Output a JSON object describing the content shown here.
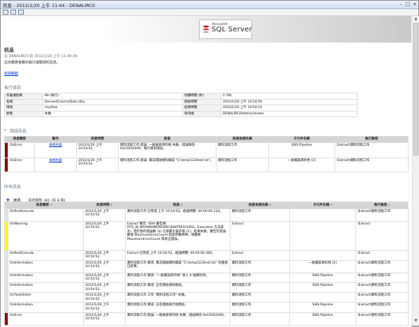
{
  "window": {
    "title": "訊息 - 2012/1/20 上午 11:44 - DENALIRC0"
  },
  "header": {
    "logo_small": "Microsoft®",
    "logo_text": "SQL Server",
    "title": "訊息",
    "subtitle": "在 DENALIRC0 的 2012/1/20 上午 11:44:34",
    "description": "這份報表會顯示執行或驗證的訊息。",
    "nav_link": "檢視概觀"
  },
  "exec_info": {
    "section": "執行資訊",
    "left": [
      {
        "label": "作業識別碼",
        "value": "89 (執行)"
      },
      {
        "label": "名稱",
        "value": "DerivedColumnData.dtsx"
      },
      {
        "label": "環境",
        "value": "/myflow"
      },
      {
        "label": "狀態",
        "value": "失敗"
      }
    ],
    "right": [
      {
        "label": "持續時間 (秒)",
        "value": "2.781"
      },
      {
        "label": "開始時間",
        "value": "2012/1/20 上午 10:54:50"
      },
      {
        "label": "結束時間",
        "value": "2012/1/20 上午 10:54:53"
      },
      {
        "label": "呼叫端",
        "value": "DENALIRC0\\Administrator"
      }
    ]
  },
  "errors": {
    "section": "錯誤訊息",
    "columns": [
      "訊息類型",
      "動作",
      "訊息時間",
      "訊息",
      "訊息來源名稱",
      "子元件名稱",
      "執行路徑"
    ],
    "rows": [
      {
        "type": "OnError",
        "action": "檢視內容",
        "time": "2012/1/20 上午 10:54:52",
        "message": "資料流程工作:錯誤: 一般檢索目的地 失敗，錯誤碼為 0xC0202009，執行目前階段。",
        "source": "資料流程工作",
        "component": "SSIS.Pipeline",
        "path": "\\Extract\\資料流程工作"
      },
      {
        "type": "OnError",
        "action": "檢視內容",
        "time": "2012/1/20 上午 10:54:52",
        "message": "資料流程工作:錯誤: 無法開啟資料檔案 \"C:\\temp\\123test.txt\"。",
        "source": "資料流程工作",
        "component": "一般檔案目的地 [2]",
        "path": "\\Extract\\資料流程工作"
      }
    ]
  },
  "all_messages": {
    "section": "所有訊息",
    "filter_label": "篩選:",
    "filter_value": "訊息類型: All; (共 4 個)",
    "columns": [
      "訊息類型",
      "訊息時間",
      "訊息",
      "訊息來源名稱",
      "子元件名稱",
      "執行路徑"
    ],
    "rows": [
      {
        "type": "OnPostExecute",
        "time": "2012/1/20 上午 10:54:52",
        "message": "資料流程工作 已完成 上午 10:54:52，經過時間: 00:00:00.234。",
        "source": "資料流程工作",
        "component": "",
        "path": "\\Extract\\資料流程工作"
      },
      {
        "type": "OnWarning",
        "time": "2012/1/20 上午 10:54:52",
        "message": "Extract 警告: SSIS 警告碼 DTS_W_MAXIMUMERRORCOUNTREACHED。Execution 方法成功，但引發的錯誤數 (2) 已達最大容許值 (1)；結果失敗。警告於錯誤數達 MaximumErrorCount 指定的數目時。請變更 MaximumErrorCount 或修正錯誤。",
        "source": "Extract",
        "component": "",
        "path": "\\Extract"
      },
      {
        "type": "OnPostExecute",
        "time": "2012/1/20 上午 10:54:52",
        "message": "Extract 已完成 上午 10:54:52，經過時間: 00:00:00.360。",
        "source": "Extract",
        "component": "",
        "path": "\\Extract"
      },
      {
        "type": "OnInformation",
        "time": "2012/1/20 上午 10:54:52",
        "message": "資料流程工作:資訊: 無法開啟資料檔案 \"C:\\temp\\123test.txt\" 的連接已結束。",
        "source": "資料流程工作",
        "component": "一般檔案目的地 [2]",
        "path": "\\Extract\\資料流程工作"
      },
      {
        "type": "OnInformation",
        "time": "2012/1/20 上午 10:54:52",
        "message": "資料流程工作:資訊: \"一般檔案目的地\" 寫入 0 個資料列。",
        "source": "資料流程工作",
        "component": "SSIS.Pipeline",
        "path": "\\Extract\\資料流程工作"
      },
      {
        "type": "OnInformation",
        "time": "2012/1/20 上午 10:54:52",
        "message": "資料流程工作:資訊: 正在開始清除階段。",
        "source": "資料流程工作",
        "component": "SSIS.Pipeline",
        "path": "\\Extract\\資料流程工作"
      },
      {
        "type": "OnTaskFailed",
        "time": "2012/1/20 上午 10:54:52",
        "message": "資料流程工作 工作 \"資料流程工作\" 失敗。",
        "source": "資料流程工作",
        "component": "",
        "path": "\\Extract\\資料流程工作"
      },
      {
        "type": "OnInformation",
        "time": "2012/1/20 上午 10:54:52",
        "message": "資料流程工作:資訊: 正在開始執行後階段。",
        "source": "資料流程工作",
        "component": "SSIS.Pipeline",
        "path": "\\Extract\\資料流程工作"
      },
      {
        "type": "OnError",
        "time": "2012/1/20 上午 10:54:52",
        "message": "資料流程工作:錯誤: 一般檢索目的地 失敗，錯誤碼為 0xC0202009。",
        "source": "資料流程工作",
        "component": "SSIS.Pipeline",
        "path": "\\Extract\\資料流程工作"
      }
    ]
  },
  "colors": {
    "error": "#8b0000",
    "warning": "#ffff00",
    "link": "#0033cc"
  }
}
